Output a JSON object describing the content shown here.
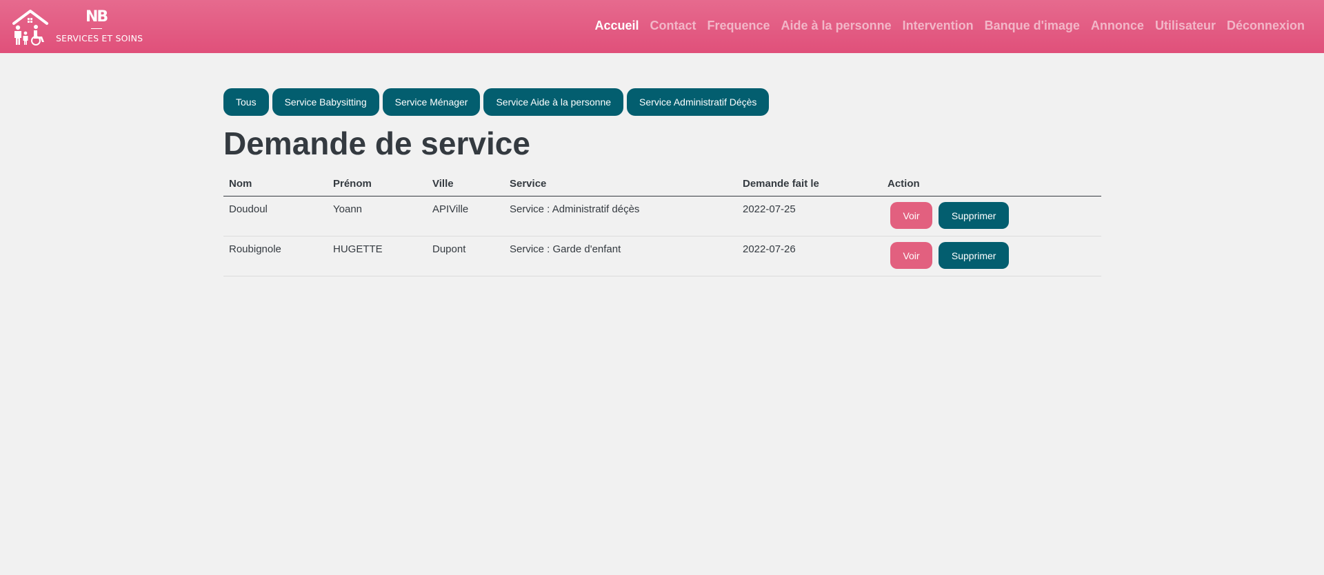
{
  "header": {
    "logo_mark": "NB",
    "logo_text": "SERVICES ET SOINS",
    "nav": [
      {
        "label": "Accueil",
        "active": true
      },
      {
        "label": "Contact"
      },
      {
        "label": "Frequence"
      },
      {
        "label": "Aide à la personne"
      },
      {
        "label": "Intervention"
      },
      {
        "label": "Banque d'image"
      },
      {
        "label": "Annonce"
      },
      {
        "label": "Utilisateur"
      },
      {
        "label": "Déconnexion"
      }
    ]
  },
  "filters": [
    "Tous",
    "Service Babysitting",
    "Service Ménager",
    "Service Aide à la personne",
    "Service Administratif Déçès"
  ],
  "page_title": "Demande de service",
  "table": {
    "columns": [
      "Nom",
      "Prénom",
      "Ville",
      "Service",
      "Demande fait le",
      "Action"
    ],
    "rows": [
      {
        "nom": "Doudoul",
        "prenom": "Yoann",
        "ville": "APIVille",
        "service": "Service : Administratif déçès",
        "date": "2022-07-25"
      },
      {
        "nom": "Roubignole",
        "prenom": "HUGETTE",
        "ville": "Dupont",
        "service": "Service : Garde d'enfant",
        "date": "2022-07-26"
      }
    ],
    "view_label": "Voir",
    "delete_label": "Supprimer"
  },
  "colors": {
    "header": "#e0507a",
    "primary": "#035e6f",
    "accent": "#e2607f",
    "background": "#f1f1f1"
  },
  "icons": {
    "logo": "house-family-icon"
  }
}
